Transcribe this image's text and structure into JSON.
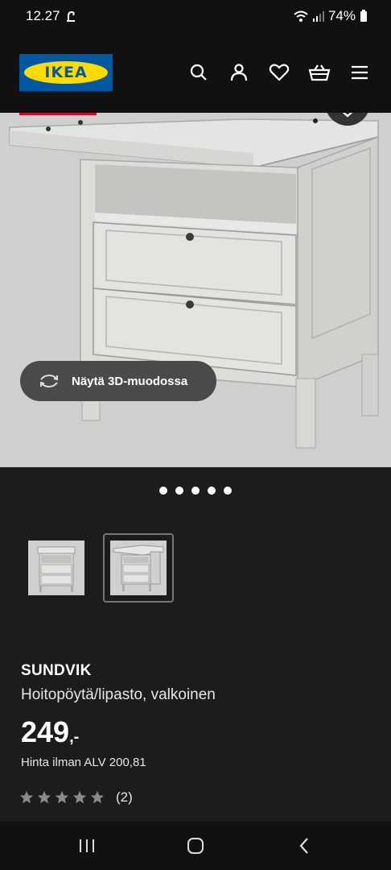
{
  "status_bar": {
    "time": "12.27",
    "battery": "74%"
  },
  "header": {
    "logo_text": "IKEA",
    "icons": [
      "search-icon",
      "account-icon",
      "heart-icon",
      "basket-icon",
      "menu-icon"
    ]
  },
  "gallery": {
    "view_3d_label": "Näytä 3D-muodossa",
    "dot_count": 5,
    "thumbnails": [
      "thumbnail-1",
      "thumbnail-2"
    ]
  },
  "product": {
    "name": "SUNDVIK",
    "description": "Hoitopöytä/lipasto, valkoinen",
    "price": "249",
    "price_suffix": ",-",
    "price_vat": "Hinta ilman ALV 200,81",
    "rating_count": "(2)"
  },
  "colors": {
    "background": "#1c1c1c",
    "bar": "#111111",
    "brand_blue": "#0058a3",
    "brand_yellow": "#ffdb00",
    "sale_red": "#c8102e"
  }
}
